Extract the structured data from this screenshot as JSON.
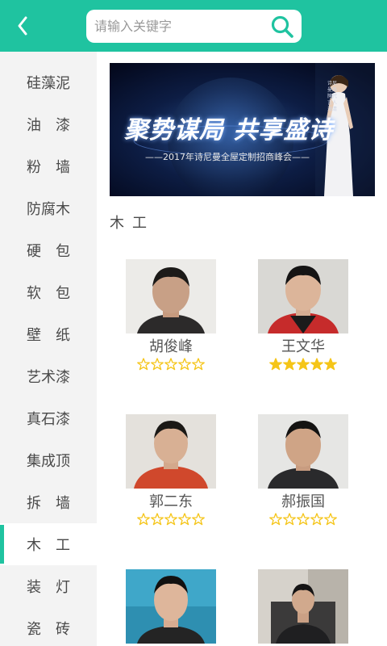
{
  "header": {
    "search_placeholder": "请输入关键字"
  },
  "sidebar": {
    "active_index": 11,
    "items": [
      {
        "label": "硅藻泥"
      },
      {
        "label": "油　漆"
      },
      {
        "label": "粉　墙"
      },
      {
        "label": "防腐木"
      },
      {
        "label": "硬　包"
      },
      {
        "label": "软　包"
      },
      {
        "label": "壁　纸"
      },
      {
        "label": "艺术漆"
      },
      {
        "label": "真石漆"
      },
      {
        "label": "集成顶"
      },
      {
        "label": "拆　墙"
      },
      {
        "label": "木　工"
      },
      {
        "label": "装　灯"
      },
      {
        "label": "瓷　砖"
      }
    ]
  },
  "banner": {
    "title": "聚势谋局 共享盛诗",
    "subtitle": "——2017年诗尼曼全屋定制招商峰会——",
    "side_text": "诗尼曼品牌代言人 海清"
  },
  "section": {
    "title": "木工"
  },
  "workers": [
    {
      "name": "胡俊峰",
      "rating": 0
    },
    {
      "name": "王文华",
      "rating": 5
    },
    {
      "name": "郭二东",
      "rating": 0
    },
    {
      "name": "郝振国",
      "rating": 0
    },
    {
      "name": "",
      "rating": 0
    },
    {
      "name": "",
      "rating": 0
    }
  ],
  "colors": {
    "accent": "#1fc3a0",
    "star_filled": "#f5c518",
    "star_empty": "#f5c518"
  }
}
